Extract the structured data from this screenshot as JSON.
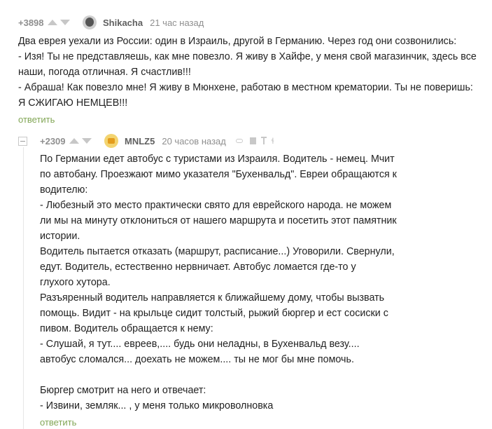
{
  "comment1": {
    "rating": "+3898",
    "author": "Shikacha",
    "time": "21 час назад",
    "lines": [
      "Два еврея уехали из России: один в Израиль, другой в Германию. Через год они созвонились:",
      "- Изя! Ты не представляешь, как мне повезло. Я живу в Хайфе, у меня свой магазинчик, здесь все",
      "наши, погода отличная. Я счастлив!!!",
      "- Абраша! Как повезло мне! Я живу в Мюнхене, работаю в местном крематории. Ты не поверишь:",
      "Я СЖИГАЮ НЕМЦЕВ!!!"
    ],
    "reply": "ответить"
  },
  "comment2": {
    "rating": "+2309",
    "author": "MNLZ5",
    "time": "20 часов назад",
    "lines": [
      "По Германии едет автобус с туристами из Израиля. Водитель - немец. Мчит",
      "по автобану. Проезжают мимо указателя \"Бухенвальд\". Евреи обращаются к",
      "водителю:",
      "- Любезный это место практически свято для еврейского народа. не можем",
      "ли мы на минуту отклониться от нашего маршрута и посетить этот памятник",
      "истории.",
      "Водитель пытается отказать (маршрут, расписание...) Уговорили. Свернули,",
      "едут. Водитель, естественно нервничает. Автобус ломается где-то у",
      "глухого хутора.",
      "Разъяренный водитель направляется к ближайшему дому, чтобы вызвать",
      "помощь. Видит - на крыльце сидит толстый, рыжий бюргер и ест сосиски с",
      "пивом. Водитель обращается к нему:",
      "- Слушай, я тут.... евреев,.... будь они неладны, в Бухенвальд везу....",
      "автобус сломался... доехать не можем.... ты не мог бы мне помочь.",
      "",
      "Бюргер смотрит на него и отвечает:",
      "- Извини, земляк... , у меня только микроволновка"
    ],
    "reply": "ответить"
  }
}
